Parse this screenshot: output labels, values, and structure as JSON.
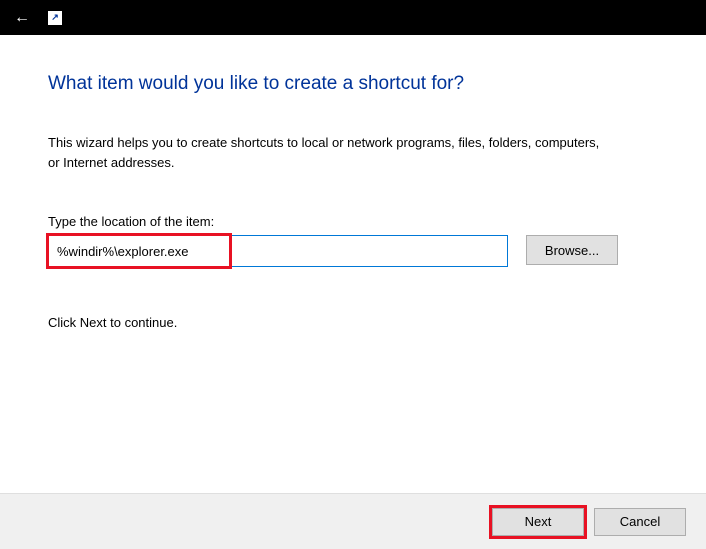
{
  "titlebar": {
    "icon_label": "↗"
  },
  "heading": "What item would you like to create a shortcut for?",
  "description": "This wizard helps you to create shortcuts to local or network programs, files, folders, computers, or Internet addresses.",
  "field_label": "Type the location of the item:",
  "location_value": "%windir%\\explorer.exe",
  "browse_label": "Browse...",
  "continue_text": "Click Next to continue.",
  "footer": {
    "next_label": "Next",
    "cancel_label": "Cancel"
  }
}
